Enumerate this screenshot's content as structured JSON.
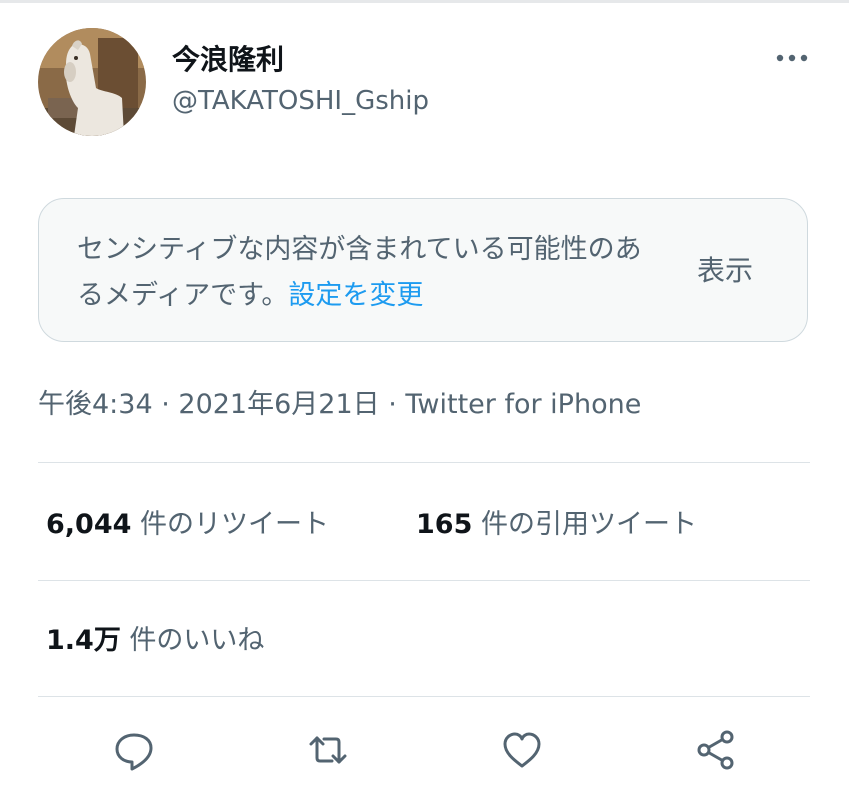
{
  "author": {
    "display_name": "今浪隆利",
    "handle": "@TAKATOSHI_Gship"
  },
  "sensitive_notice": {
    "message": "センシティブな内容が含まれている可能性のあるメディアです。",
    "settings_link": "設定を変更",
    "show_button": "表示"
  },
  "meta": {
    "time": "午後4:34",
    "separator": " · ",
    "date": "2021年6月21日",
    "client": "Twitter for iPhone"
  },
  "stats": {
    "retweets": {
      "count": "6,044",
      "label": " 件のリツイート"
    },
    "quotes": {
      "count": "165",
      "label": " 件の引用ツイート"
    },
    "likes": {
      "count": "1.4万",
      "label": " 件のいいね"
    }
  },
  "actions": [
    "reply-icon",
    "retweet-icon",
    "like-icon",
    "share-icon"
  ],
  "colors": {
    "link": "#1d9bf0",
    "secondary_text": "#536471",
    "primary_text": "#0f1419",
    "icon": "#536471"
  }
}
